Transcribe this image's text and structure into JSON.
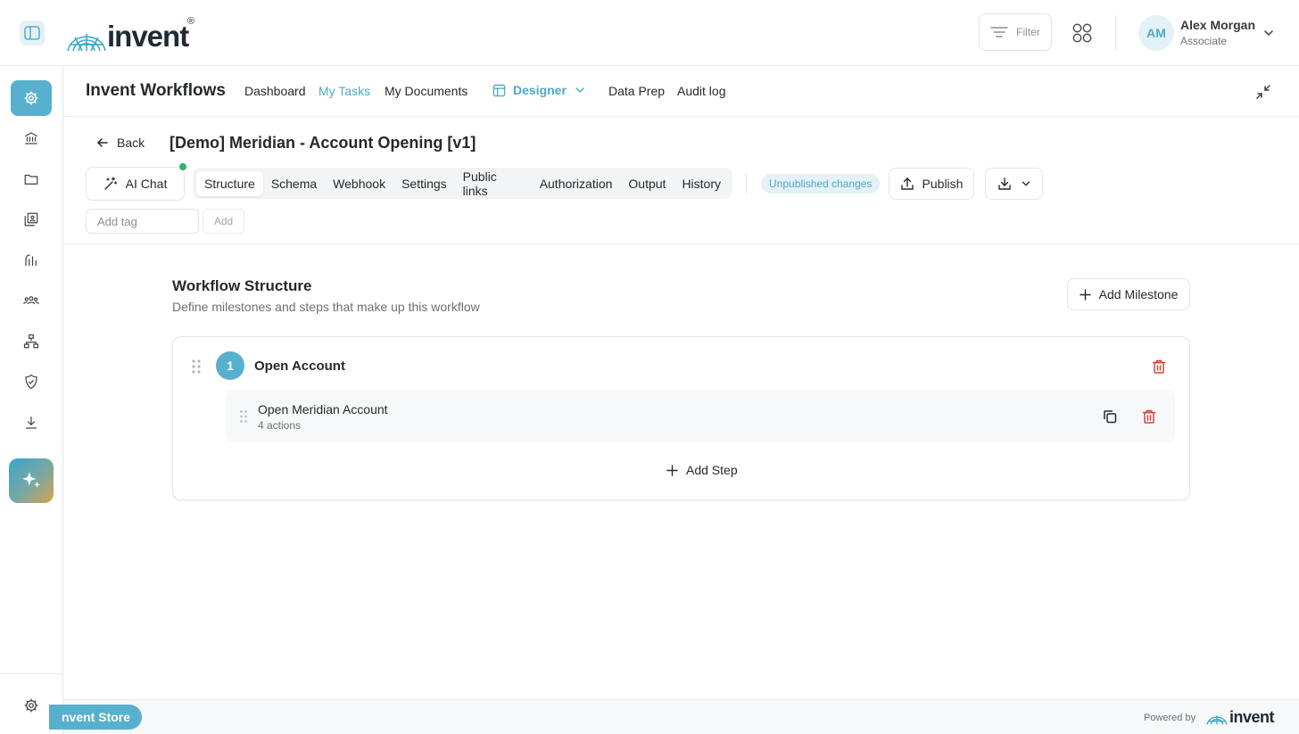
{
  "brand": {
    "logo_text": "invent",
    "registered": "®",
    "accent": "#57b0cd"
  },
  "topbar": {
    "filter_label": "Filter",
    "user": {
      "initials": "AM",
      "name": "Alex Morgan",
      "role": "Associate"
    }
  },
  "leftnav": {
    "items": [
      "gear-icon",
      "bank-icon",
      "folder-icon",
      "documents-icon",
      "analytics-icon",
      "team-icon",
      "hierarchy-icon",
      "shield-check-icon",
      "download-icon"
    ],
    "active": "gear-icon"
  },
  "subnav": {
    "app_title": "Invent Workflows",
    "links": [
      "Dashboard",
      "My Tasks",
      "My Documents"
    ],
    "designer_label": "Designer",
    "links_right": [
      "Data Prep",
      "Audit log"
    ],
    "active_link": "My Tasks"
  },
  "workflow": {
    "back_label": "Back",
    "title": "[Demo] Meridian - Account Opening [v1]",
    "ai_chat_label": "AI Chat",
    "tabs": [
      "Structure",
      "Schema",
      "Webhook",
      "Settings",
      "Public links",
      "Authorization",
      "Output",
      "History"
    ],
    "active_tab": "Structure",
    "status_badge": "Unpublished changes",
    "publish_label": "Publish",
    "tag_placeholder": "Add tag",
    "tag_add_label": "Add"
  },
  "structure": {
    "title": "Workflow Structure",
    "subtitle": "Define milestones and steps that make up this workflow",
    "add_milestone_label": "Add Milestone",
    "milestones": [
      {
        "number": "1",
        "title": "Open Account",
        "steps": [
          {
            "title": "Open Meridian Account",
            "subtitle": "4 actions"
          }
        ],
        "add_step_label": "Add Step"
      }
    ]
  },
  "footer": {
    "store_label": "nvent Store",
    "powered_by": "Powered by",
    "powered_logo_text": "invent"
  }
}
